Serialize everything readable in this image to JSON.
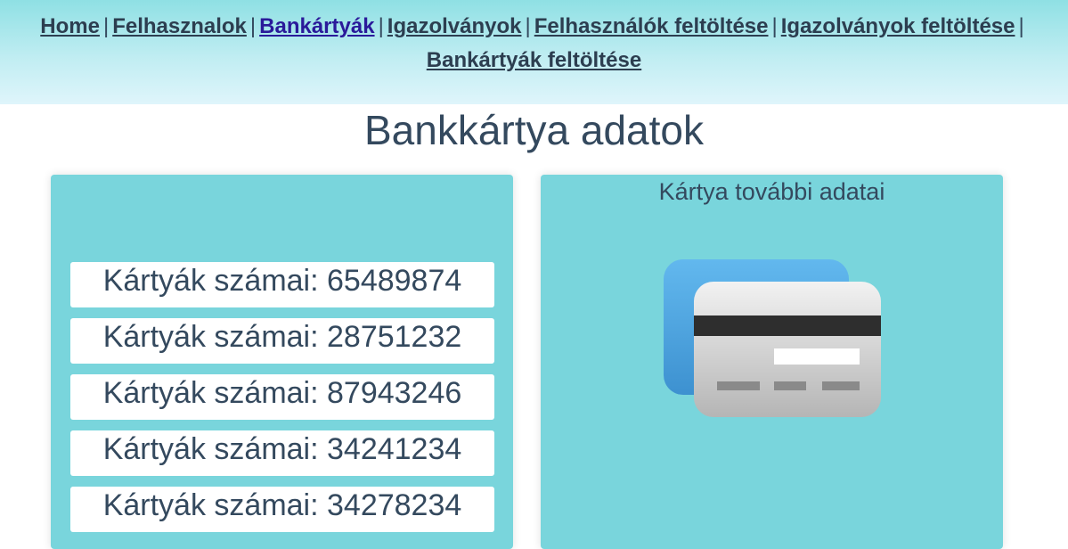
{
  "nav": {
    "items": [
      {
        "label": "Home",
        "active": false
      },
      {
        "label": "Felhasznalok",
        "active": false
      },
      {
        "label": "Bankártyák",
        "active": true
      },
      {
        "label": "Igazolványok",
        "active": false
      },
      {
        "label": "Felhasználók feltöltése",
        "active": false
      },
      {
        "label": "Igazolványok feltöltése",
        "active": false
      },
      {
        "label": "Bankártyák feltöltése",
        "active": false
      }
    ],
    "separator": "|"
  },
  "page": {
    "title": "Bankkártya adatok"
  },
  "card_list": {
    "items": [
      "Kártyák számai: 65489874",
      "Kártyák számai: 28751232",
      "Kártyák számai: 87943246",
      "Kártyák számai: 34241234",
      "Kártyák számai: 34278234"
    ]
  },
  "details": {
    "title": "Kártya további adatai",
    "icon": "credit-card-icon"
  },
  "colors": {
    "panel": "#79d5dc",
    "text": "#34495e",
    "active_link": "#2a1a9a"
  }
}
